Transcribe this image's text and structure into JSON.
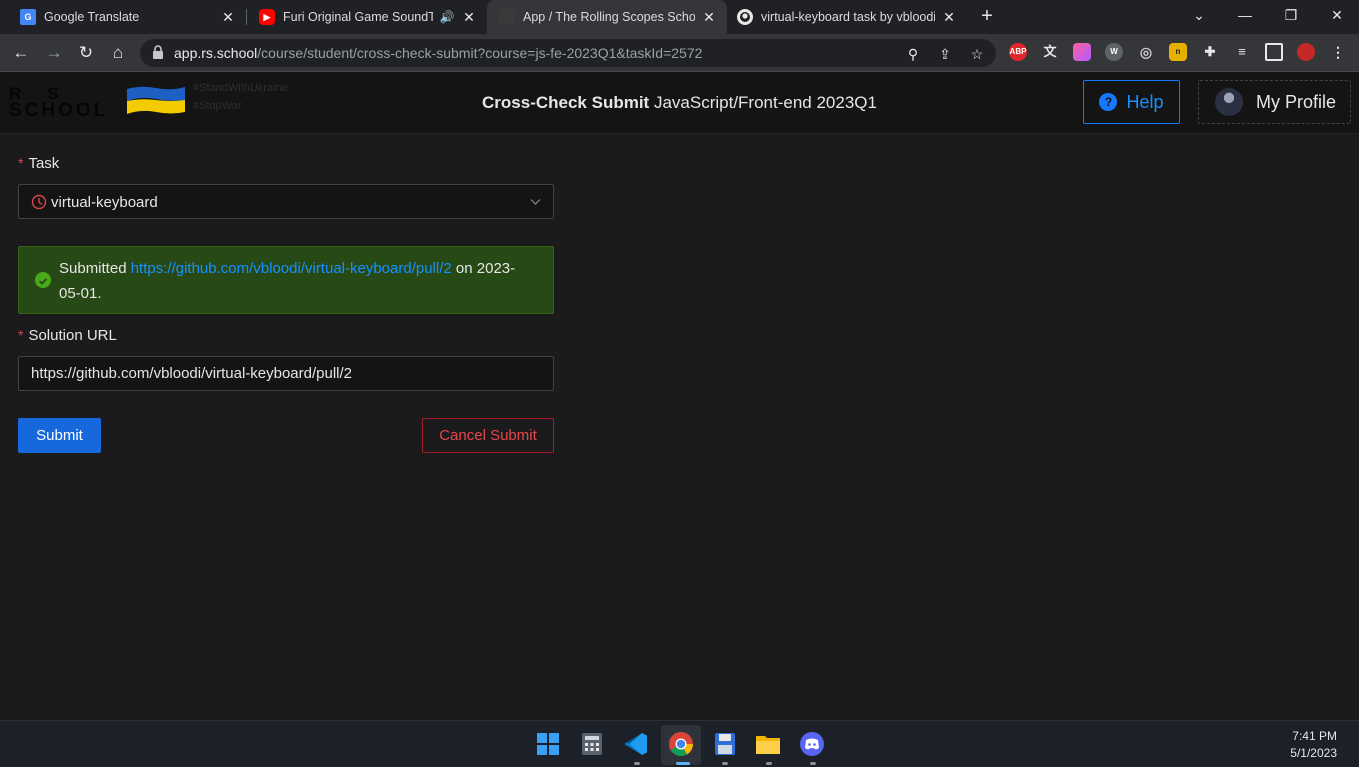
{
  "browser": {
    "tabs": [
      {
        "title": "Google Translate",
        "favicon": "google-translate-icon",
        "active": false
      },
      {
        "title": "Furi Original Game SoundTra",
        "favicon": "youtube-icon",
        "active": false
      },
      {
        "title": "App / The Rolling Scopes School",
        "favicon": "rs-school-icon",
        "active": true
      },
      {
        "title": "virtual-keyboard task by vbloodi",
        "favicon": "github-icon",
        "active": false
      }
    ],
    "url_host": "app.rs.school",
    "url_path": "/course/student/cross-check-submit?course=js-fe-2023Q1&taskId=2572",
    "extensions": [
      "ABP",
      "W",
      "W"
    ]
  },
  "header": {
    "logo_line1": "RS",
    "logo_line2": "SCHOOL",
    "slogan_1": "#StandWithUkraine",
    "slogan_2": "#StopWar",
    "title_bold": "Cross-Check Submit",
    "title_rest": "JavaScript/Front-end 2023Q1",
    "help_label": "Help",
    "profile_label": "My Profile"
  },
  "form": {
    "task_label": "Task",
    "task_value": "virtual-keyboard",
    "alert_prefix": "Submitted",
    "alert_link": "https://github.com/vbloodi/virtual-keyboard/pull/2",
    "alert_on": "on",
    "alert_date": "2023-05-01.",
    "solution_label": "Solution URL",
    "solution_value": "https://github.com/vbloodi/virtual-keyboard/pull/2",
    "submit_label": "Submit",
    "cancel_label": "Cancel Submit"
  },
  "taskbar": {
    "time": "7:41 PM",
    "date": "5/1/2023"
  },
  "colors": {
    "accent": "#1668dc",
    "link": "#1890ff",
    "success_bg": "#274916",
    "danger": "#e84749"
  }
}
